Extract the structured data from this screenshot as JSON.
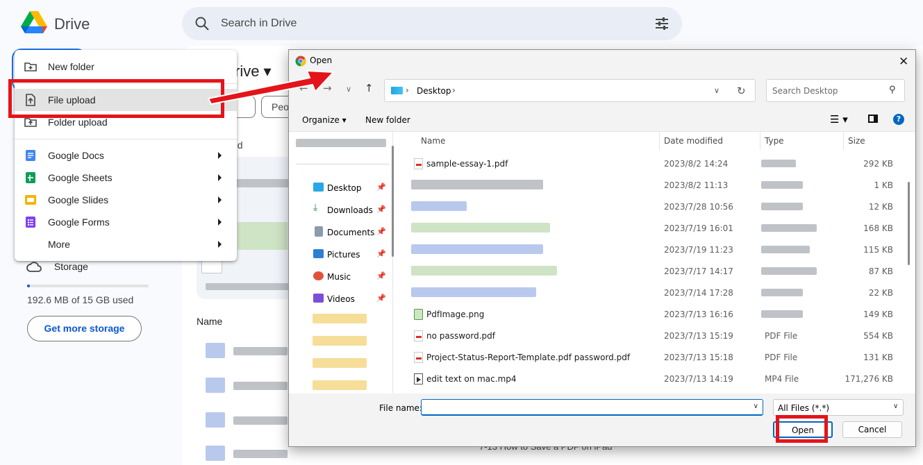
{
  "drive": {
    "brand": "Drive",
    "search_placeholder": "Search in Drive",
    "my_drive_title": "rive ▾",
    "chip_partial": "Peo",
    "suggested_partial": "ed",
    "name_header": "Name",
    "storage_label": "Storage",
    "storage_used_text": "192.6 MB of 15 GB used",
    "storage_fraction": 0.013,
    "get_more_storage": "Get more storage",
    "bottom_file_partial": "7-13 How to Save a PDF on iPad"
  },
  "new_menu": {
    "items": [
      {
        "label": "New folder",
        "icon": "new-folder-icon"
      },
      {
        "label": "File upload",
        "icon": "file-upload-icon"
      },
      {
        "label": "Folder upload",
        "icon": "folder-upload-icon"
      },
      {
        "label": "Google Docs",
        "icon": "google-docs-icon",
        "color": "#4285f4"
      },
      {
        "label": "Google Sheets",
        "icon": "google-sheets-icon",
        "color": "#0f9d58"
      },
      {
        "label": "Google Slides",
        "icon": "google-slides-icon",
        "color": "#f4b400"
      },
      {
        "label": "Google Forms",
        "icon": "google-forms-icon",
        "color": "#7e3ff2"
      },
      {
        "label": "More",
        "icon": ""
      }
    ]
  },
  "dialog": {
    "title": "Open",
    "address": "Desktop",
    "search_placeholder": "Search Desktop",
    "organize": "Organize ▾",
    "new_folder": "New folder",
    "nav": [
      {
        "label": "Desktop",
        "color": "#2aa8e6"
      },
      {
        "label": "Downloads",
        "color": "#2b8a3e"
      },
      {
        "label": "Documents",
        "color": "#8a9bb0"
      },
      {
        "label": "Pictures",
        "color": "#2d7fd3"
      },
      {
        "label": "Music",
        "color": "#e0533a"
      },
      {
        "label": "Videos",
        "color": "#7a4fd6"
      }
    ],
    "columns": {
      "name": "Name",
      "date": "Date modified",
      "type": "Type",
      "size": "Size"
    },
    "files": [
      {
        "name": "sample-essay-1.pdf",
        "date": "2023/8/2 14:24",
        "type": "",
        "size": "292 KB",
        "icon": "pdf"
      },
      {
        "name": "",
        "date": "2023/8/2 11:13",
        "type": "",
        "size": "1 KB",
        "icon": ""
      },
      {
        "name": "",
        "date": "2023/7/28 10:56",
        "type": "",
        "size": "12 KB",
        "icon": ""
      },
      {
        "name": "",
        "date": "2023/7/19 16:01",
        "type": "",
        "size": "168 KB",
        "icon": ""
      },
      {
        "name": "",
        "date": "2023/7/19 11:23",
        "type": "",
        "size": "115 KB",
        "icon": ""
      },
      {
        "name": "",
        "date": "2023/7/17 14:17",
        "type": "",
        "size": "87 KB",
        "icon": ""
      },
      {
        "name": "",
        "date": "2023/7/14 17:28",
        "type": "",
        "size": "22 KB",
        "icon": ""
      },
      {
        "name": "PdfImage.png",
        "date": "2023/7/13 16:16",
        "type": "",
        "size": "149 KB",
        "icon": "png"
      },
      {
        "name": "no password.pdf",
        "date": "2023/7/13 15:19",
        "type": "PDF File",
        "size": "554 KB",
        "icon": "pdf"
      },
      {
        "name": "Project-Status-Report-Template.pdf password.pdf",
        "date": "2023/7/13 15:18",
        "type": "PDF File",
        "size": "131 KB",
        "icon": "pdf"
      },
      {
        "name": "edit text on mac.mp4",
        "date": "2023/7/13 14:19",
        "type": "MP4 File",
        "size": "171,276 KB",
        "icon": "mp4"
      }
    ],
    "file_name_label": "File name:",
    "file_name_value": "",
    "file_type": "All Files (*.*)",
    "open_button": "Open",
    "cancel_button": "Cancel"
  },
  "colors": {
    "highlight_red": "#e4141a",
    "win_blue": "#0067c0",
    "drive_blue": "#0b57d0"
  }
}
